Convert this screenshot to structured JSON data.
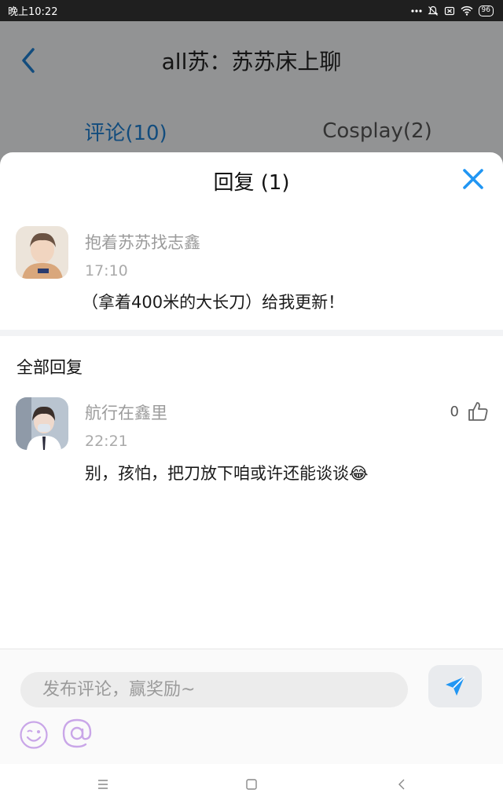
{
  "status_bar": {
    "time": "晚上10:22",
    "battery": "96"
  },
  "page": {
    "title": "all苏：苏苏床上聊",
    "tabs": [
      {
        "label": "评论(10)",
        "active": true
      },
      {
        "label": "Cosplay(2)",
        "active": false
      }
    ]
  },
  "sheet": {
    "title": "回复 (1)",
    "close_icon": "close-icon",
    "parent_comment": {
      "username": "抱着苏苏找志鑫",
      "time": "17:10",
      "text": "（拿着400米的大长刀）给我更新！"
    },
    "section_title": "全部回复",
    "replies": [
      {
        "username": "航行在鑫里",
        "time": "22:21",
        "text": "别，孩怕，把刀放下咱或许还能谈谈😂",
        "likes": "0"
      }
    ]
  },
  "composer": {
    "placeholder": "发布评论，赢奖励~",
    "send_icon": "send-icon",
    "emoji_icon": "emoji-icon",
    "mention_icon": "at-icon"
  },
  "colors": {
    "accent": "#2196f3",
    "tab_active": "#1e7fd0",
    "mention": "#c9a6e8"
  }
}
